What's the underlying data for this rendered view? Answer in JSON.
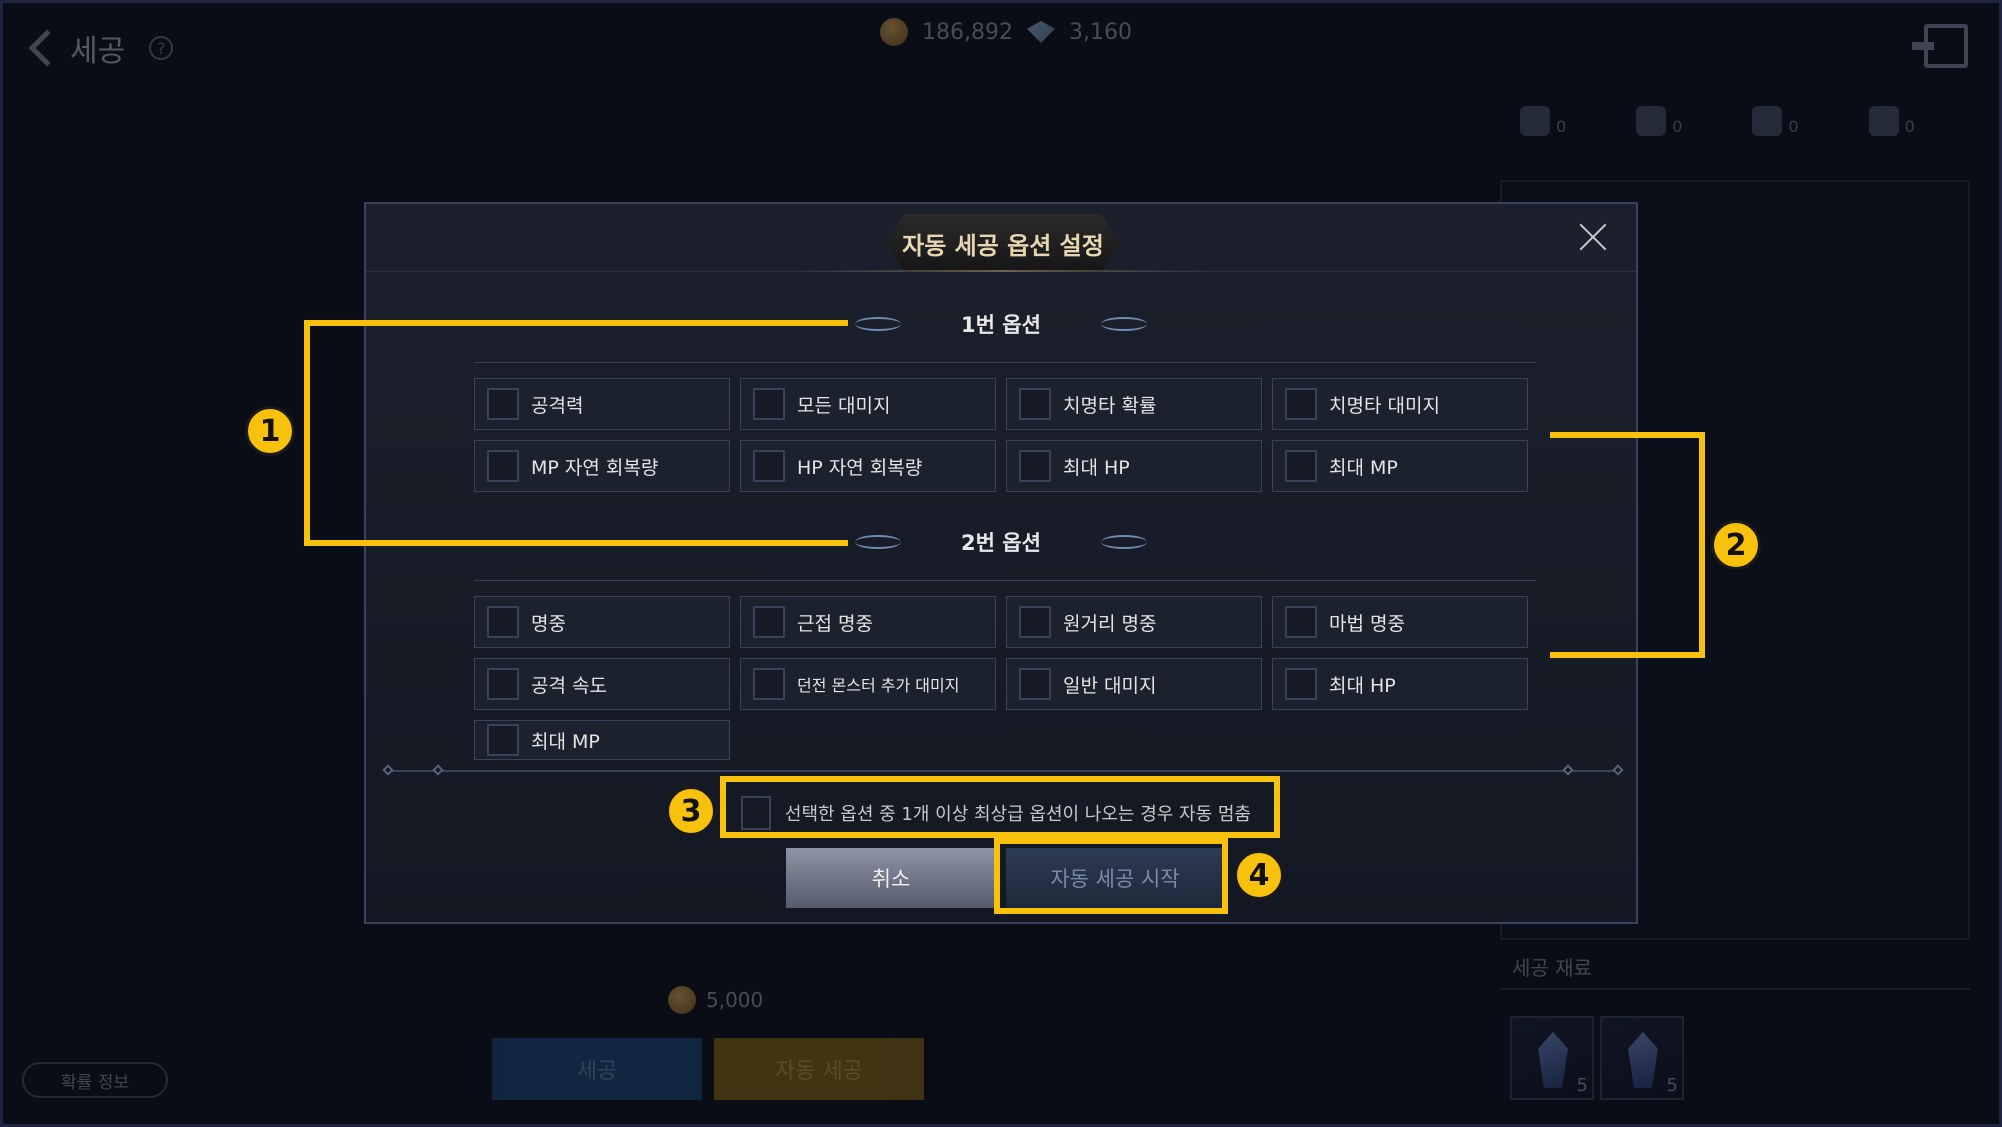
{
  "app": {
    "title": "세공"
  },
  "currency": {
    "gold": "186,892",
    "gems": "3,160"
  },
  "stats": [
    "0",
    "0",
    "0",
    "0"
  ],
  "materials": {
    "title": "세공 재료",
    "counts": [
      "5",
      "5"
    ]
  },
  "bottom": {
    "cost": "5,000",
    "refine_label": "세공",
    "auto_label": "자동 세공",
    "prob_label": "확률 정보"
  },
  "modal": {
    "title": "자동 세공 옵션 설정",
    "section1": {
      "title": "1번 옵션",
      "options": [
        "공격력",
        "모든 대미지",
        "치명타 확률",
        "치명타 대미지",
        "MP 자연 회복량",
        "HP 자연 회복량",
        "최대 HP",
        "최대 MP"
      ]
    },
    "section2": {
      "title": "2번 옵션",
      "options": [
        "명중",
        "근접 명중",
        "원거리 명중",
        "마법 명중",
        "공격 속도",
        "던전 몬스터 추가 대미지",
        "일반 대미지",
        "최대 HP",
        "최대 MP"
      ]
    },
    "stop_label": "선택한 옵션 중 1개 이상 최상급 옵션이 나오는 경우 자동 멈춤",
    "cancel_label": "취소",
    "start_label": "자동 세공 시작"
  },
  "annotations": [
    "1",
    "2",
    "3",
    "4"
  ],
  "colors": {
    "highlight": "#f8c20c",
    "modal_bg": "#1a1e2a",
    "title_text": "#e8d6b0"
  }
}
